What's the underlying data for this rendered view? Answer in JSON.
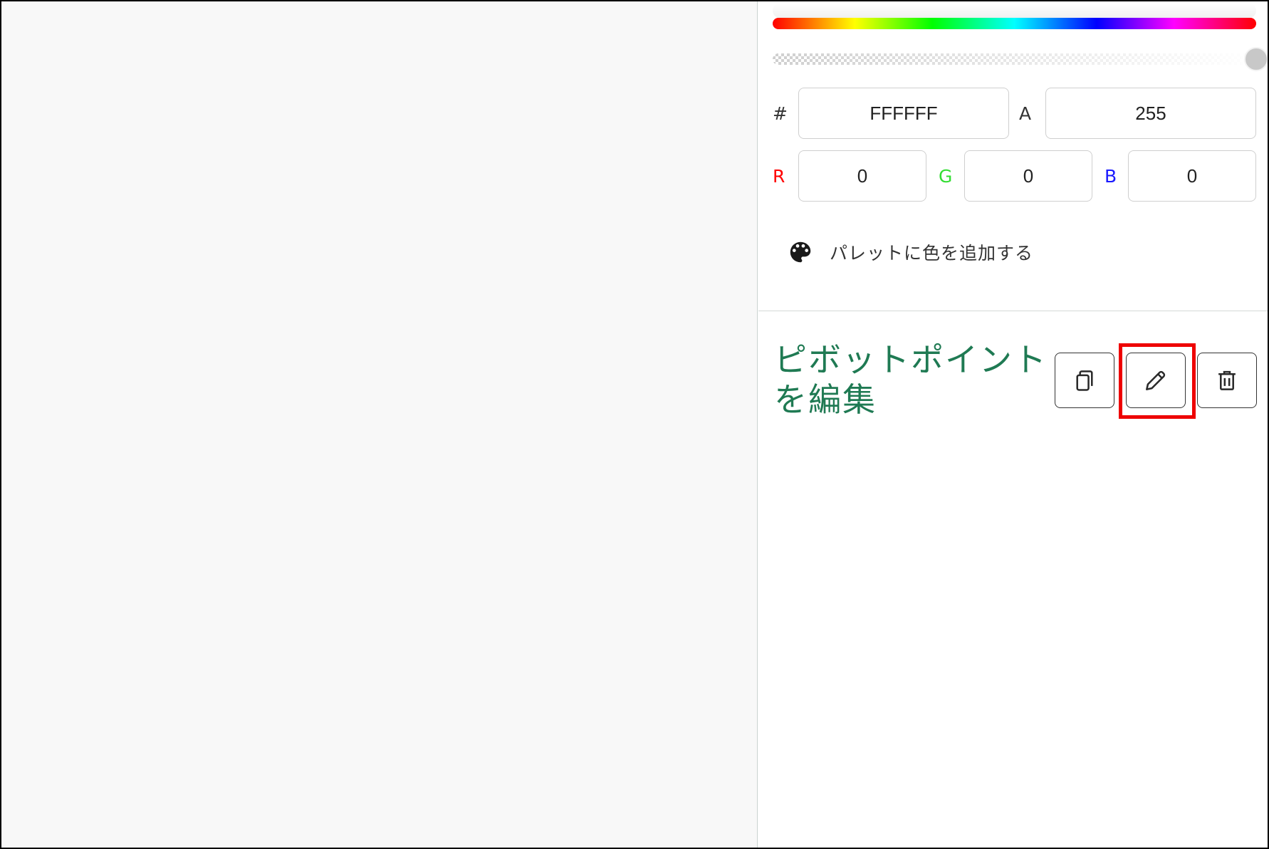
{
  "color_picker": {
    "hex_label": "#",
    "hex_value": "FFFFFF",
    "alpha_label": "A",
    "alpha_value": "255",
    "r_label": "R",
    "r_value": "0",
    "g_label": "G",
    "g_value": "0",
    "b_label": "B",
    "b_value": "0",
    "alpha_slider_level": 1.0
  },
  "palette": {
    "add_label": "パレットに色を追加する",
    "icon": "palette-icon"
  },
  "section": {
    "title": "ピボットポイントを編集",
    "buttons": [
      {
        "icon": "copy-icon"
      },
      {
        "icon": "pencil-icon",
        "highlighted": true
      },
      {
        "icon": "trash-icon"
      }
    ]
  },
  "colors": {
    "title_green": "#1f7a53",
    "r_label": "#ff0000",
    "g_label": "#33dd33",
    "b_label": "#1a1aff",
    "highlight": "#ee0000"
  }
}
